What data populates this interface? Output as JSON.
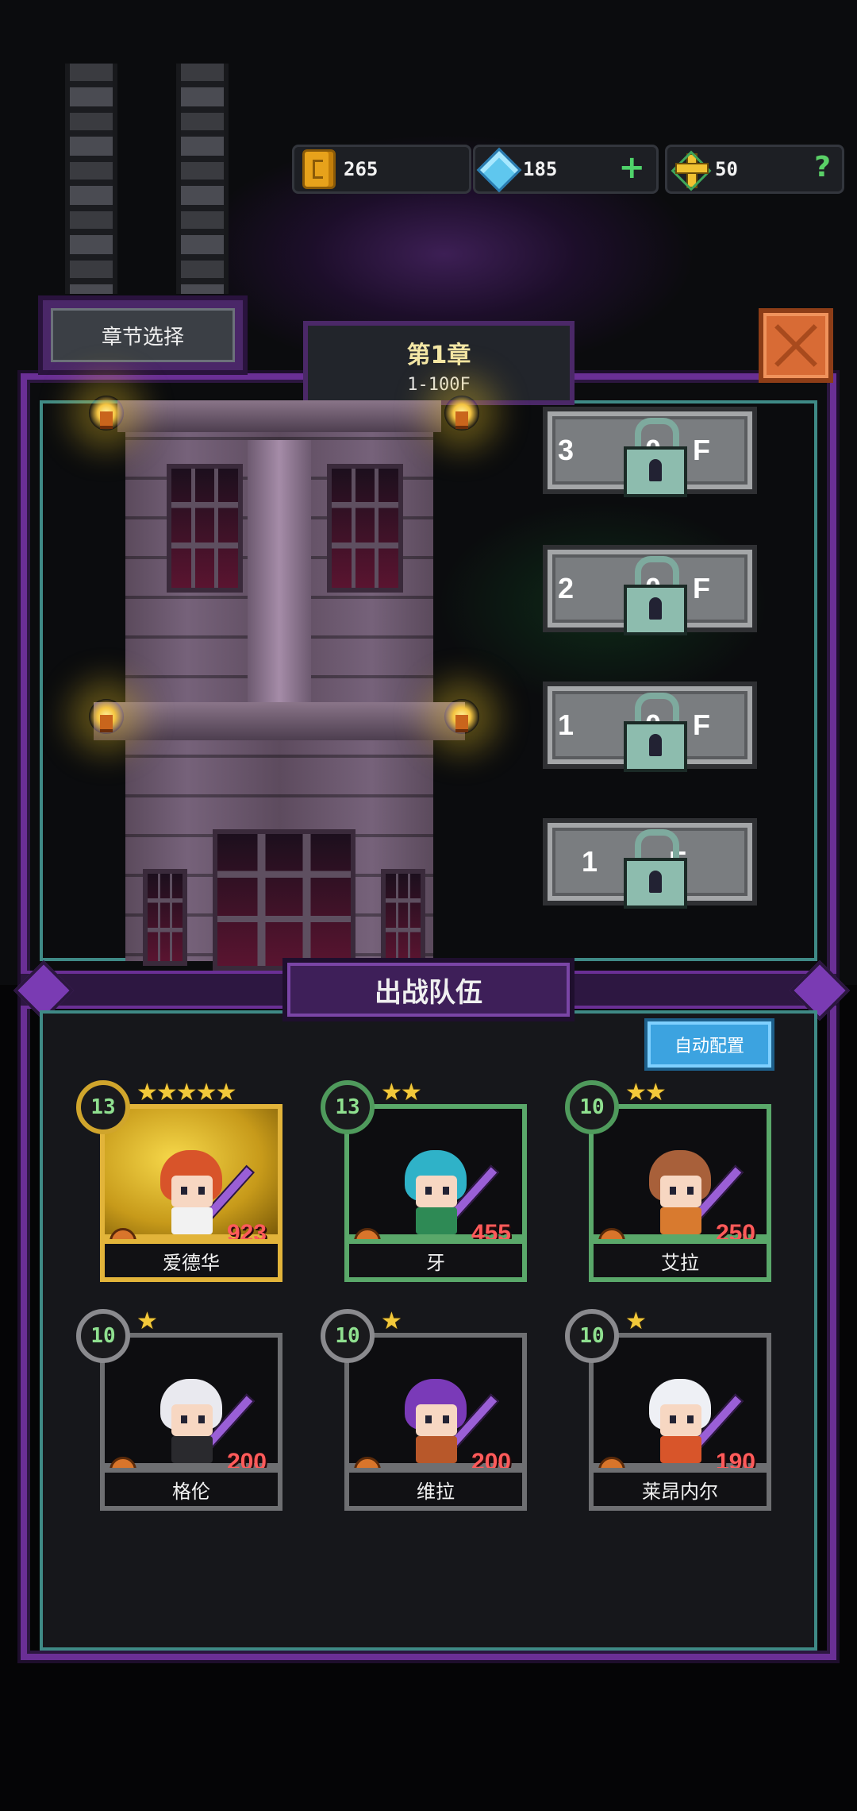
{
  "resources": {
    "gold": {
      "icon": "gold-coin-icon",
      "value": "265"
    },
    "gems": {
      "icon": "blue-gem-icon",
      "value": "185",
      "action": "+"
    },
    "keys": {
      "icon": "cross-key-icon",
      "value": "50",
      "action": "?"
    }
  },
  "chapter_select_label": "章节选择",
  "chapter": {
    "title": "第1章",
    "range": "1-100F"
  },
  "floors": [
    {
      "label": "3  0F",
      "locked": true
    },
    {
      "label": "2  0F",
      "locked": true
    },
    {
      "label": "1  0F",
      "locked": true
    },
    {
      "label": "1  F",
      "locked": true
    }
  ],
  "team": {
    "title": "出战队伍",
    "auto_button": "自动配置",
    "heroes": [
      {
        "name": "爱德华",
        "level": "13",
        "stars": "★★★★★",
        "power": "923",
        "rarity": "gold",
        "hair": "#d8542a",
        "outfit": "#f2f2f2"
      },
      {
        "name": "牙",
        "level": "13",
        "stars": "★★",
        "power": "455",
        "rarity": "green",
        "hair": "#2fb2c8",
        "outfit": "#2e8a55"
      },
      {
        "name": "艾拉",
        "level": "10",
        "stars": "★★",
        "power": "250",
        "rarity": "green",
        "hair": "#a8603a",
        "outfit": "#d87a2f"
      },
      {
        "name": "格伦",
        "level": "10",
        "stars": "★",
        "power": "200",
        "rarity": "gray",
        "hair": "#e9e9ef",
        "outfit": "#2a2a2e"
      },
      {
        "name": "维拉",
        "level": "10",
        "stars": "★",
        "power": "200",
        "rarity": "gray",
        "hair": "#7a3ab8",
        "outfit": "#b8582a"
      },
      {
        "name": "莱昂内尔",
        "level": "10",
        "stars": "★",
        "power": "190",
        "rarity": "gray",
        "hair": "#eef0f5",
        "outfit": "#d8552a"
      }
    ]
  }
}
